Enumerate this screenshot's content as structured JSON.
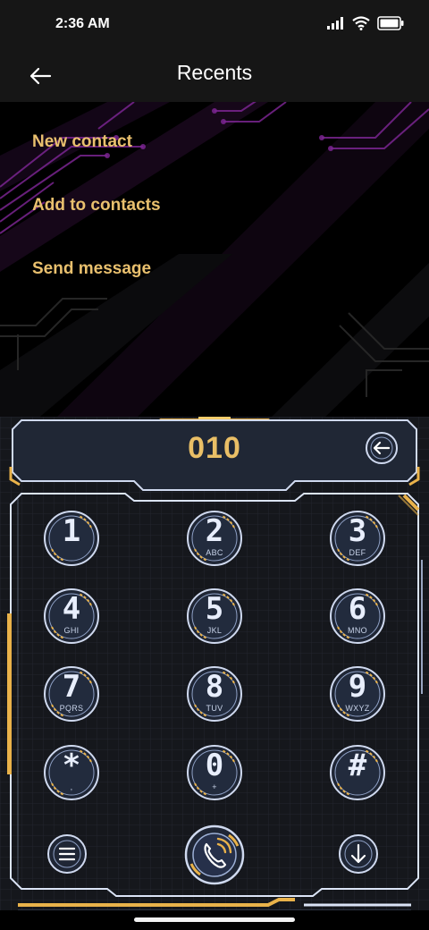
{
  "status_bar": {
    "time": "2:36 AM",
    "icons": [
      "signal-icon",
      "wifi-icon",
      "battery-icon"
    ]
  },
  "header": {
    "title": "Recents",
    "back_icon": "arrow-left-icon"
  },
  "menu": {
    "items": [
      {
        "label": "New contact"
      },
      {
        "label": "Add to contacts"
      },
      {
        "label": "Send message"
      }
    ]
  },
  "dialer": {
    "number": "010",
    "delete_icon": "backspace-arrow-icon",
    "keys": [
      {
        "digit": "1",
        "letters": ""
      },
      {
        "digit": "2",
        "letters": "ABC"
      },
      {
        "digit": "3",
        "letters": "DEF"
      },
      {
        "digit": "4",
        "letters": "GHI"
      },
      {
        "digit": "5",
        "letters": "JKL"
      },
      {
        "digit": "6",
        "letters": "MNO"
      },
      {
        "digit": "7",
        "letters": "PQRS"
      },
      {
        "digit": "8",
        "letters": "TUV"
      },
      {
        "digit": "9",
        "letters": "WXYZ"
      },
      {
        "digit": "*",
        "letters": ","
      },
      {
        "digit": "0",
        "letters": "+"
      },
      {
        "digit": "#",
        "letters": ""
      }
    ],
    "bottom_buttons": [
      "menu-icon",
      "call-icon",
      "collapse-icon"
    ]
  },
  "colors": {
    "accent": "#e9c06e",
    "panel_bg": "#15171c",
    "frame": "#d6e0f5",
    "key_ring": "#b9c9ea",
    "purple": "#6a1f78"
  }
}
